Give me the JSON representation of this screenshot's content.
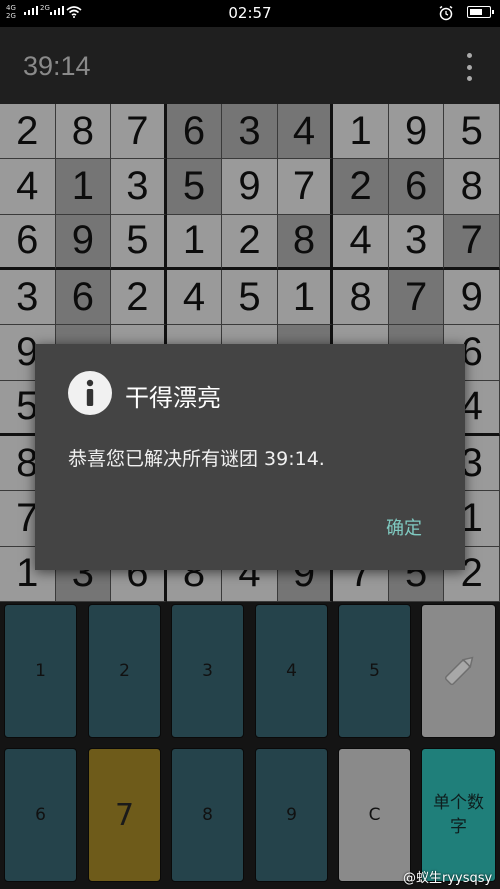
{
  "status_bar": {
    "network_1": "4G",
    "network_2": "2G",
    "network_3": "2G",
    "time": "02:57"
  },
  "app_bar": {
    "timer": "39:14",
    "menu_icon": "more-vert-icon"
  },
  "board": {
    "rows": [
      [
        "2",
        "8",
        "7",
        "6",
        "3",
        "4",
        "1",
        "9",
        "5"
      ],
      [
        "4",
        "1",
        "3",
        "5",
        "9",
        "7",
        "2",
        "6",
        "8"
      ],
      [
        "6",
        "9",
        "5",
        "1",
        "2",
        "8",
        "4",
        "3",
        "7"
      ],
      [
        "3",
        "6",
        "2",
        "4",
        "5",
        "1",
        "8",
        "7",
        "9"
      ],
      [
        "9",
        "",
        "",
        "",
        "",
        "",
        "",
        "",
        "6"
      ],
      [
        "5",
        "",
        "",
        "",
        "",
        "",
        "",
        "",
        "4"
      ],
      [
        "8",
        "",
        "",
        "",
        "",
        "",
        "",
        "",
        "3"
      ],
      [
        "7",
        "",
        "",
        "",
        "",
        "",
        "",
        "",
        "1"
      ],
      [
        "1",
        "3",
        "6",
        "8",
        "4",
        "9",
        "7",
        "5",
        "2"
      ]
    ]
  },
  "keypad": {
    "row1": [
      "1",
      "2",
      "3",
      "4",
      "5"
    ],
    "pencil_icon": "pencil-icon",
    "row2": [
      "6",
      "7",
      "8",
      "9",
      "C"
    ],
    "mode_label_line1": "单个数",
    "mode_label_line2": "字"
  },
  "dialog": {
    "icon": "info-icon",
    "title": "干得漂亮",
    "message": "恭喜您已解决所有谜团 39:14.",
    "ok_label": "确定"
  },
  "watermark": "@蚁生ryysqsy",
  "colors": {
    "dialog_bg": "#444444",
    "ok_accent": "#7fc9c0",
    "key_teal": "#25434b",
    "key_selected": "#6e5b1a",
    "key_mode": "#1f7f7a"
  }
}
